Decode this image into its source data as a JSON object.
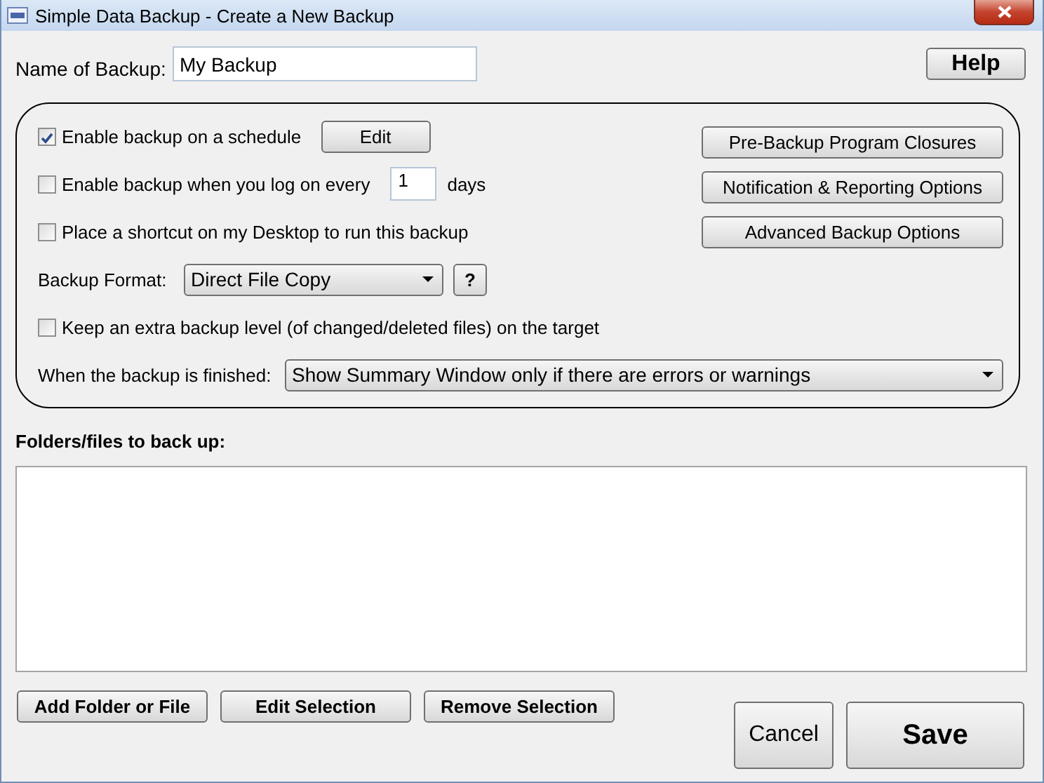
{
  "window": {
    "title": "Simple Data Backup - Create a New Backup"
  },
  "name_field": {
    "label": "Name of Backup:",
    "value": "My Backup"
  },
  "help_button": "Help",
  "options": [
    {
      "kind": "check",
      "label": "Enable backup on a schedule",
      "checked": true,
      "button": "Edit"
    },
    {
      "kind": "check",
      "label": "Enable backup when you log on every",
      "checked": false,
      "count": "1",
      "unit": "days"
    },
    {
      "kind": "check",
      "label": "Place a shortcut on my Desktop to run this backup",
      "checked": false
    },
    {
      "kind": "select",
      "label": "Backup Format:",
      "value": "Direct File Copy",
      "help_button": "?"
    },
    {
      "kind": "check",
      "label": "Keep an extra backup level (of changed/deleted files) on the target",
      "checked": false
    }
  ],
  "side_buttons": [
    "Pre-Backup Program Closures",
    "Notification & Reporting Options",
    "Advanced Backup Options"
  ],
  "when_finished": {
    "label": "When the backup is finished:",
    "value": "Show Summary Window only if there are errors or warnings"
  },
  "folders": {
    "label": "Folders/files to back up:"
  },
  "list_buttons": [
    "Add Folder or File",
    "Edit Selection",
    "Remove Selection"
  ],
  "cancel_button": "Cancel",
  "save_button": "Save"
}
